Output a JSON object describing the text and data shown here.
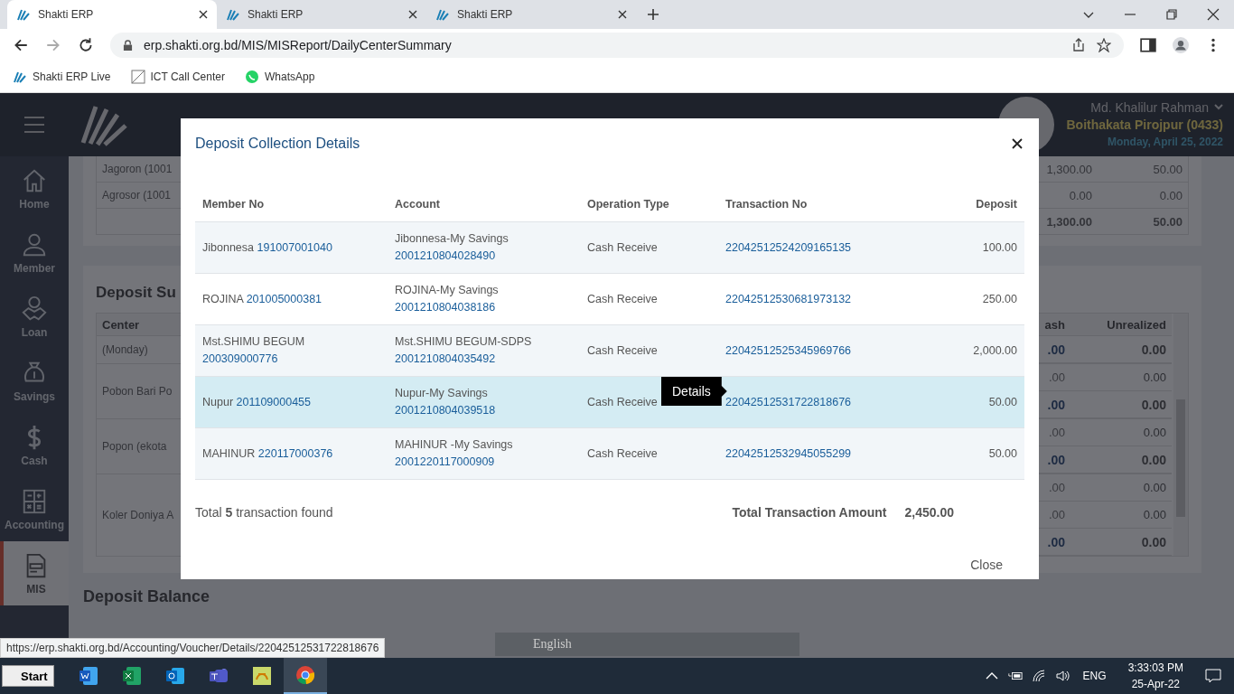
{
  "browser": {
    "tabs": [
      {
        "title": "Shakti ERP",
        "selected": true
      },
      {
        "title": "Shakti ERP",
        "selected": false
      },
      {
        "title": "Shakti ERP",
        "selected": false
      }
    ],
    "address": "erp.shakti.org.bd/MIS/MISReport/DailyCenterSummary",
    "bookmarks": [
      "Shakti ERP Live",
      "ICT Call Center",
      "WhatsApp"
    ],
    "status_url": "https://erp.shakti.org.bd/Accounting/Voucher/Details/22042512531722818676"
  },
  "header": {
    "user": "Md. Khalilur Rahman",
    "branch": "Boithakata Pirojpur (0433)",
    "date": "Monday, April 25, 2022"
  },
  "sidebar": [
    {
      "label": "Home",
      "selected": false
    },
    {
      "label": "Member",
      "selected": false
    },
    {
      "label": "Loan",
      "selected": false
    },
    {
      "label": "Savings",
      "selected": false
    },
    {
      "label": "Cash",
      "selected": false
    },
    {
      "label": "Accounting",
      "selected": false
    },
    {
      "label": "MIS",
      "selected": true
    }
  ],
  "summary_rows": [
    {
      "name": "Jagoron (1001",
      "value_1": "1,300.00",
      "value_2": "50.00",
      "bold": false
    },
    {
      "name": "Agrosor (1001",
      "value_1": "0.00",
      "value_2": "0.00",
      "bold": false
    },
    {
      "value_1": "1,300.00",
      "value_2": "50.00",
      "bold": true
    }
  ],
  "deposit_summary": {
    "title": "Deposit Su",
    "columns": [
      "Center",
      "ash",
      "Unrealized"
    ],
    "centers": [
      {
        "name": "(Monday)",
        "lines": [
          {
            "cash": ".00",
            "unrealized": "0.00",
            "bold": true
          }
        ]
      },
      {
        "name": "Pobon Bari Po",
        "lines": [
          {
            "cash": ".00",
            "unrealized": "0.00",
            "bold": false
          },
          {
            "cash": ".00",
            "unrealized": "0.00",
            "bold": true
          }
        ]
      },
      {
        "name": "Popon (ekota",
        "lines": [
          {
            "cash": ".00",
            "unrealized": "0.00",
            "bold": false
          },
          {
            "cash": ".00",
            "unrealized": "0.00",
            "bold": true
          }
        ]
      },
      {
        "name": "Koler Doniya A",
        "lines": [
          {
            "cash": ".00",
            "unrealized": "0.00",
            "bold": false
          },
          {
            "cash": ".00",
            "unrealized": "0.00",
            "bold": false
          },
          {
            "cash": ".00",
            "unrealized": "0.00",
            "bold": true
          }
        ]
      }
    ]
  },
  "deposit_balance": {
    "title": "Deposit Balance"
  },
  "modal": {
    "title": "Deposit Collection Details",
    "columns": [
      "Member No",
      "Account",
      "Operation Type",
      "Transaction No",
      "Deposit"
    ],
    "rows": [
      {
        "member_name": "Jibonnesa",
        "member_no": "191007001040",
        "account_name": "Jibonnesa-My Savings",
        "account_no": "2001210804028490",
        "operation": "Cash Receive",
        "transaction_no": "22042512524209165135",
        "deposit": "100.00",
        "highlighted": false
      },
      {
        "member_name": "ROJINA",
        "member_no": "201005000381",
        "account_name": "ROJINA-My Savings",
        "account_no": "2001210804038186",
        "operation": "Cash Receive",
        "transaction_no": "22042512530681973132",
        "deposit": "250.00",
        "highlighted": false
      },
      {
        "member_name": "Mst.SHIMU BEGUM",
        "member_no": "200309000776",
        "account_name": "Mst.SHIMU BEGUM-SDPS",
        "account_no": "2001210804035492",
        "operation": "Cash Receive",
        "transaction_no": "22042512525345969766",
        "deposit": "2,000.00",
        "highlighted": false
      },
      {
        "member_name": "Nupur",
        "member_no": "201109000455",
        "account_name": "Nupur-My Savings",
        "account_no": "2001210804039518",
        "operation": "Cash Receive",
        "transaction_no": "22042512531722818676",
        "deposit": "50.00",
        "highlighted": true
      },
      {
        "member_name": "MAHINUR",
        "member_no": "220117000376",
        "account_name": "MAHINUR -My Savings",
        "account_no": "2001220117000909",
        "operation": "Cash Receive",
        "transaction_no": "22042512532945055299",
        "deposit": "50.00",
        "highlighted": false
      }
    ],
    "tooltip": "Details",
    "total_text": "Total **5** transaction found",
    "total_label": "Total Transaction Amount",
    "total_amount": "2,450.00",
    "close_label": "Close"
  },
  "ime_bar": {
    "language": "English"
  },
  "taskbar": {
    "start": "Start",
    "apps": [
      {
        "active": false
      },
      {
        "active": false
      },
      {
        "active": false
      },
      {
        "active": false
      },
      {
        "active": false
      },
      {
        "active": true
      }
    ],
    "language": "ENG",
    "time": "3:33:03 PM",
    "date": "25-Apr-22"
  }
}
